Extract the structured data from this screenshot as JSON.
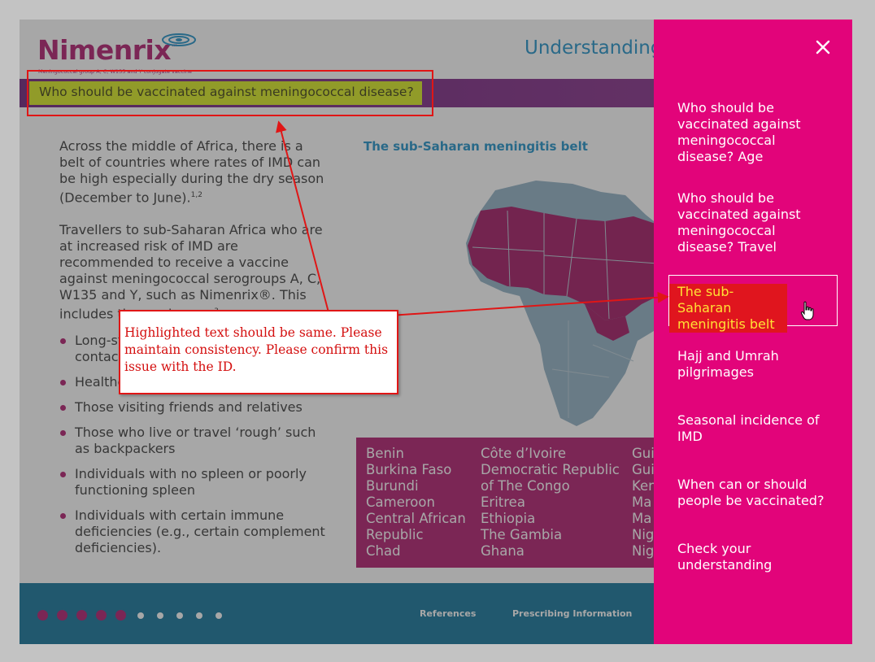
{
  "header": {
    "brand": "Nimenrix",
    "trademark": "™",
    "tagline": "Meningococcal group A, C, W135 and Y conjugate vaccine",
    "title": "Understanding"
  },
  "question": "Who should be vaccinated against meningococcal disease?",
  "body": {
    "para1": "Across the middle of Africa, there is a belt of countries where rates of IMD can be high especially during the dry season (December to June).",
    "para1_ref": "1,2",
    "para2": "Travellers to sub-Saharan Africa who are at increased risk of IMD are recommended to receive a vaccine against meningococcal serogroups A, C, W135 and Y, such as Nimenrix®. This includes those who are:",
    "para2_ref": "3",
    "bullets": [
      "Long-stay travellers who have close contact with the local population",
      "Healthcare workers",
      "Those visiting friends and relatives",
      "Those who live or travel ‘rough’ such as backpackers",
      "Individuals with no spleen or poorly functioning spleen",
      "Individuals with certain immune deficiencies (e.g., certain complement deficiencies)."
    ]
  },
  "map": {
    "title": "The sub-Saharan meningitis belt",
    "countries_col1": [
      "Benin",
      "Burkina Faso",
      "Burundi",
      "Cameroon",
      "Central African",
      "Republic",
      "Chad"
    ],
    "countries_col2": [
      "Côte d’Ivoire",
      "Democratic Republic",
      "of The Congo",
      "Eritrea",
      "Ethiopia",
      "The Gambia",
      "Ghana"
    ],
    "countries_col3": [
      "Gui",
      "Gui",
      "Ken",
      "Ma",
      "Ma",
      "Nig",
      "Nig"
    ]
  },
  "footer": {
    "references": "References",
    "prescribing": "Prescribing Information",
    "progress_filled": 5,
    "progress_total": 10
  },
  "menu": {
    "items": [
      "Who should be vaccinated against meningococcal disease? Age",
      "Who should be vaccinated against meningococcal disease? Travel",
      "The sub-Saharan meningitis belt",
      "Hajj and Umrah pilgrimages",
      "Seasonal incidence of IMD",
      "When can or should people be vaccinated?",
      "Check your understanding"
    ],
    "active_index": 2
  },
  "annotation": {
    "note": "Highlighted text should be same. Please maintain consistency. Please confirm this issue with the ID."
  },
  "colors": {
    "accent": "#e2047a",
    "brand": "#b0146a",
    "highlight": "#d7ea1b",
    "footer": "#0c6f98",
    "annotation": "#e01616"
  }
}
